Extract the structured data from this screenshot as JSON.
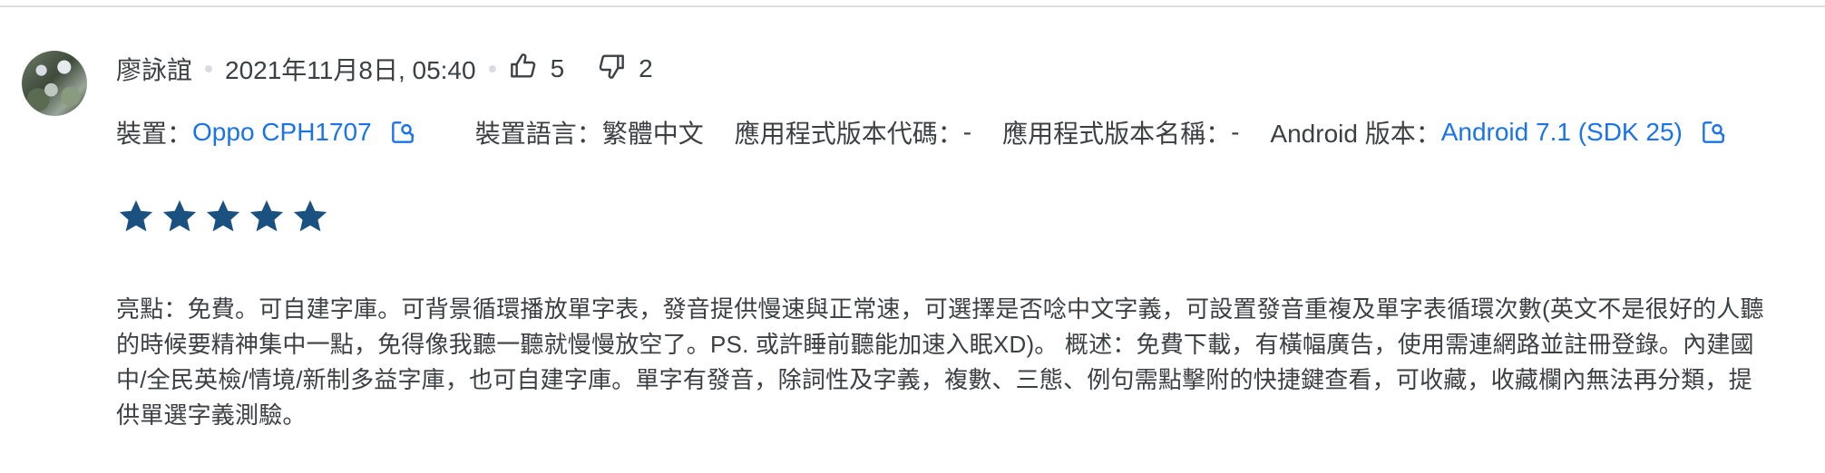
{
  "review": {
    "author": "廖詠誼",
    "date": "2021年11月8日, 05:40",
    "up_votes": "5",
    "down_votes": "2",
    "device_label": "裝置：",
    "device_value": "Oppo CPH1707",
    "language_label": "裝置語言：",
    "language_value": "繁體中文",
    "version_code_label": "應用程式版本代碼：",
    "version_code_value": "-",
    "version_name_label": "應用程式版本名稱：",
    "version_name_value": "-",
    "android_label": "Android 版本：",
    "android_value": "Android 7.1 (SDK 25)",
    "rating": 5,
    "rating_max": 5,
    "text": "亮點：免費。可自建字庫。可背景循環播放單字表，發音提供慢速與正常速，可選擇是否唸中文字義，可設置發音重複及單字表循環次數(英文不是很好的人聽的時候要精神集中一點，免得像我聽一聽就慢慢放空了。PS. 或許睡前聽能加速入眠XD)。 概述：免費下載，有橫幅廣告，使用需連網路並註冊登錄。內建國中/全民英檢/情境/新制多益字庫，也可自建字庫。單字有發音，除詞性及字義，複數、三態、例句需點擊附的快捷鍵查看，可收藏，收藏欄內無法再分類，提供單選字義測驗。"
  },
  "colors": {
    "link": "#1a73e8",
    "star": "#1a5180",
    "text": "#3c4043",
    "divider": "#dadce0"
  },
  "icons": {
    "up_vote": "thumb-up-outline-icon",
    "down_vote": "thumb-down-outline-icon",
    "open_device": "open-in-new-icon",
    "open_android": "open-in-new-icon",
    "star": "star-filled-icon"
  }
}
